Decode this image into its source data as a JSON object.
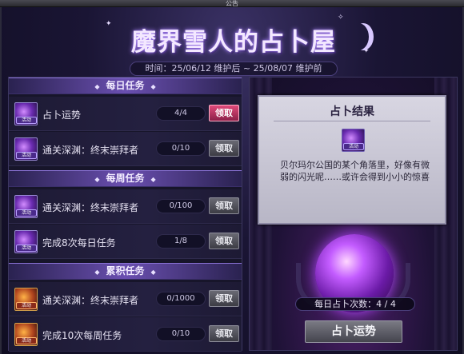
{
  "window": {
    "title": "公告"
  },
  "header": {
    "title": "魔界雪人的占卜屋",
    "period": "时间：25/06/12 维护后 ~ 25/08/07 维护前"
  },
  "sections": [
    {
      "title": "每日任务"
    },
    {
      "title": "每周任务"
    },
    {
      "title": "累积任务"
    }
  ],
  "tasks": [
    {
      "name": "占卜运势",
      "count": "4/4",
      "button": "领取",
      "button_state": "active",
      "icon": "fortune-orb-icon",
      "icon_tag": "活动"
    },
    {
      "name": "通关深渊：终末崇拜者",
      "count": "0/10",
      "button": "领取",
      "button_state": "disabled",
      "icon": "fortune-orb-icon",
      "icon_tag": "活动"
    },
    {
      "name": "通关深渊：终末崇拜者",
      "count": "0/100",
      "button": "领取",
      "button_state": "disabled",
      "icon": "fortune-orb-icon",
      "icon_tag": "活动"
    },
    {
      "name": "完成8次每日任务",
      "count": "1/8",
      "button": "领取",
      "button_state": "disabled",
      "icon": "fortune-orb-icon",
      "icon_tag": "活动"
    },
    {
      "name": "通关深渊：终末崇拜者",
      "count": "0/1000",
      "button": "领取",
      "button_state": "disabled",
      "icon": "treasure-box-icon",
      "icon_tag": "活动"
    },
    {
      "name": "完成10次每周任务",
      "count": "0/10",
      "button": "领取",
      "button_state": "disabled",
      "icon": "treasure-box-icon",
      "icon_tag": "活动"
    }
  ],
  "result": {
    "title": "占卜结果",
    "icon_tag": "活动",
    "text": "贝尔玛尔公国的某个角落里，好像有微弱的闪光呢……或许会得到小小的惊喜"
  },
  "fortune": {
    "daily_count": "每日占卜次数：4 / 4",
    "button": "占卜运势"
  },
  "colors": {
    "accent": "#6a4fb0",
    "active_button": "#e04a7a",
    "panel_bg": "#17152a"
  }
}
